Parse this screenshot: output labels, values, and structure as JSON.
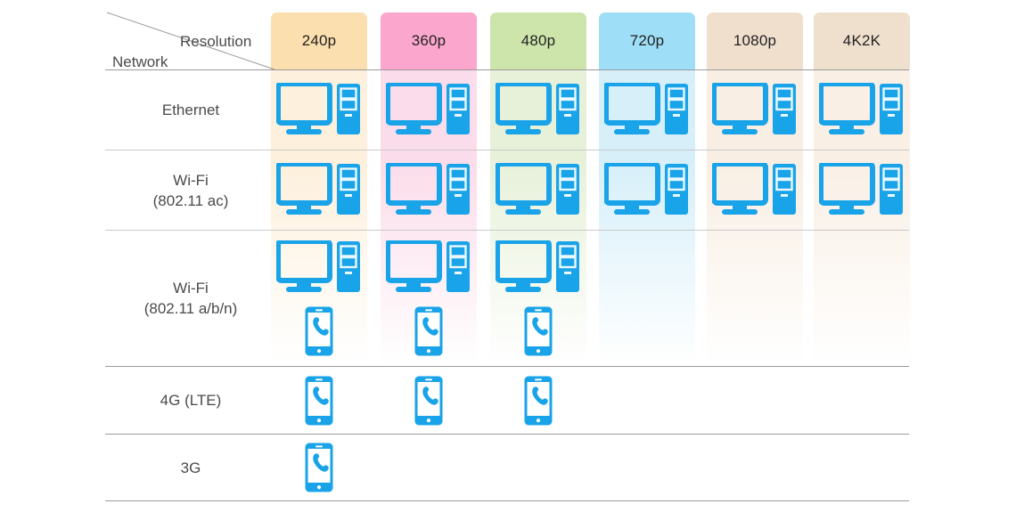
{
  "chart_data": {
    "type": "table",
    "title": "",
    "axis_corner": {
      "column_axis": "Resolution",
      "row_axis": "Network"
    },
    "categories": [
      "240p",
      "360p",
      "480p",
      "720p",
      "1080p",
      "4K2K"
    ],
    "rows": [
      "Ethernet",
      "Wi-Fi (802.11 ac)",
      "Wi-Fi (802.11 a/b/n)",
      "4G (LTE)",
      "3G"
    ],
    "cells": [
      [
        "pc",
        "pc",
        "pc",
        "pc",
        "pc",
        "pc"
      ],
      [
        "pc",
        "pc",
        "pc",
        "pc",
        "pc",
        "pc"
      ],
      [
        "pc+phone",
        "pc+phone",
        "pc+phone",
        "",
        "",
        ""
      ],
      [
        "phone",
        "phone",
        "phone",
        "",
        "",
        ""
      ],
      [
        "phone",
        "",
        "",
        "",
        "",
        ""
      ]
    ],
    "legend": [],
    "xlabel": "Resolution",
    "ylabel": "Network"
  },
  "header": {
    "corner": {
      "resolution_label": "Resolution",
      "network_label": "Network"
    },
    "columns": [
      {
        "label": "240p",
        "color": "#fbdfae",
        "tint": "#fdf0dc"
      },
      {
        "label": "360p",
        "color": "#fba6cd",
        "tint": "#fbdcea"
      },
      {
        "label": "480p",
        "color": "#cde5ab",
        "tint": "#e7f1d9"
      },
      {
        "label": "720p",
        "color": "#9fdef7",
        "tint": "#d6eff9"
      },
      {
        "label": "1080p",
        "color": "#f0dfcd",
        "tint": "#f8eee3"
      },
      {
        "label": "4K2K",
        "color": "#efdfcd",
        "tint": "#f9efe5"
      }
    ]
  },
  "rows": [
    {
      "label_line1": "Ethernet",
      "label_line2": "",
      "icons": [
        "pc",
        "pc",
        "pc",
        "pc",
        "pc",
        "pc"
      ]
    },
    {
      "label_line1": "Wi-Fi",
      "label_line2": "(802.11 ac)",
      "icons": [
        "pc",
        "pc",
        "pc",
        "pc",
        "pc",
        "pc"
      ]
    },
    {
      "label_line1": "Wi-Fi",
      "label_line2": "(802.11 a/b/n)",
      "icons": [
        "pc-phone",
        "pc-phone",
        "pc-phone",
        "",
        "",
        ""
      ]
    },
    {
      "label_line1": "4G (LTE)",
      "label_line2": "",
      "icons": [
        "phone",
        "phone",
        "phone",
        "",
        "",
        ""
      ]
    },
    {
      "label_line1": "3G",
      "label_line2": "",
      "icons": [
        "phone",
        "",
        "",
        "",
        "",
        ""
      ]
    }
  ],
  "icons": {
    "pc_name": "desktop-computer-icon",
    "phone_name": "mobile-phone-icon",
    "accent_color": "#19a3e8"
  },
  "theme": {
    "accent": "#19a3e8",
    "rule_color": "#9a9a9a",
    "text_color": "#4a4a4a"
  }
}
